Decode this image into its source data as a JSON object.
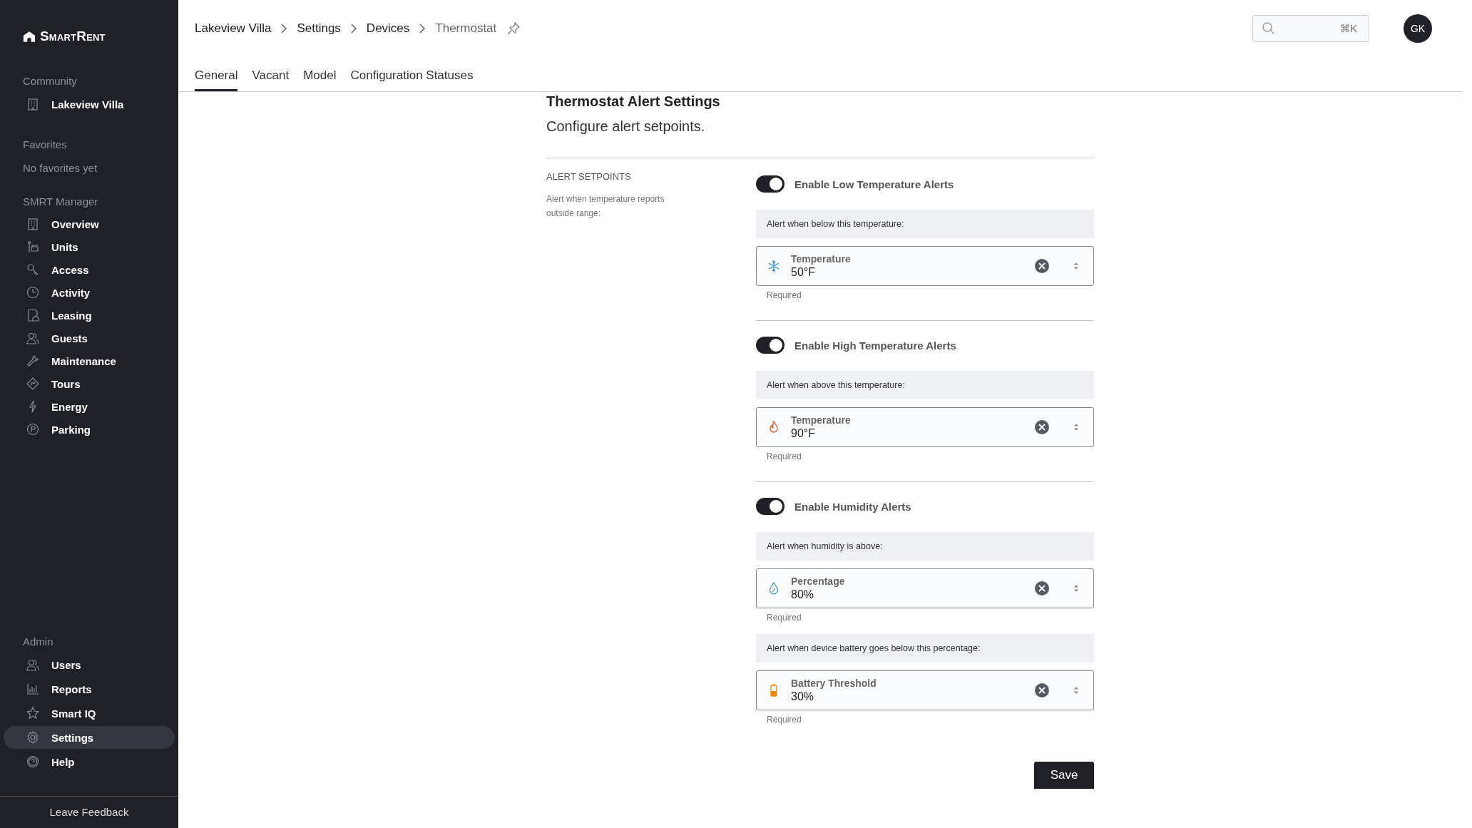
{
  "sidebar": {
    "logo": "SmartRent",
    "sections": [
      {
        "title": "Community",
        "items": [
          {
            "label": "Lakeview Villa",
            "selected": false
          }
        ]
      },
      {
        "title": "Favorites",
        "empty_text": "No favorites yet"
      },
      {
        "title": "SMRT Manager",
        "items": [
          {
            "label": "Overview",
            "selected": false
          },
          {
            "label": "Units",
            "selected": false
          },
          {
            "label": "Access",
            "selected": false
          },
          {
            "label": "Activity",
            "selected": false
          },
          {
            "label": "Leasing",
            "selected": false
          },
          {
            "label": "Guests",
            "selected": false
          },
          {
            "label": "Maintenance",
            "selected": false
          },
          {
            "label": "Tours",
            "selected": false
          },
          {
            "label": "Energy",
            "selected": false
          },
          {
            "label": "Parking",
            "selected": false
          }
        ]
      },
      {
        "title": "Admin",
        "items": [
          {
            "label": "Users",
            "selected": false
          },
          {
            "label": "Reports",
            "selected": false
          },
          {
            "label": "Smart IQ",
            "selected": false
          },
          {
            "label": "Settings",
            "selected": true
          },
          {
            "label": "Help",
            "selected": false
          }
        ]
      }
    ],
    "footer": "Leave Feedback"
  },
  "header": {
    "breadcrumbs": [
      "Lakeview Villa",
      "Settings",
      "Devices",
      "Thermostat"
    ],
    "search_shortcut": "⌘K",
    "avatar": "GK"
  },
  "tabs": [
    {
      "label": "General",
      "selected": true
    },
    {
      "label": "Vacant",
      "selected": false
    },
    {
      "label": "Model",
      "selected": false
    },
    {
      "label": "Configuration Statuses",
      "selected": false
    }
  ],
  "form": {
    "title": "Thermostat Alert Settings",
    "subtitle": "Configure alert setpoints.",
    "section_title": "ALERT SETPOINTS",
    "section_description": "Alert when temperature reports outside range:",
    "groups": [
      {
        "toggle": {
          "label": "Enable Low Temperature Alerts",
          "on": true
        },
        "setpoints": [
          {
            "hint": "Alert when below this temperature:",
            "kind": "cold",
            "label": "Temperature",
            "value": "50°F",
            "helper": "Required"
          }
        ]
      },
      {
        "toggle": {
          "label": "Enable High Temperature Alerts",
          "on": true
        },
        "setpoints": [
          {
            "hint": "Alert when above this temperature:",
            "kind": "heat",
            "label": "Temperature",
            "value": "90°F",
            "helper": "Required"
          }
        ]
      },
      {
        "toggle": {
          "label": "Enable Humidity Alerts",
          "on": true
        },
        "setpoints": [
          {
            "hint": "Alert when humidity is above:",
            "kind": "humidity",
            "label": "Percentage",
            "value": "80%",
            "helper": "Required"
          },
          {
            "hint": "Alert when device battery goes below this percentage:",
            "kind": "battery",
            "label": "Battery Threshold",
            "value": "30%",
            "helper": "Required"
          }
        ]
      }
    ],
    "save": "Save"
  }
}
